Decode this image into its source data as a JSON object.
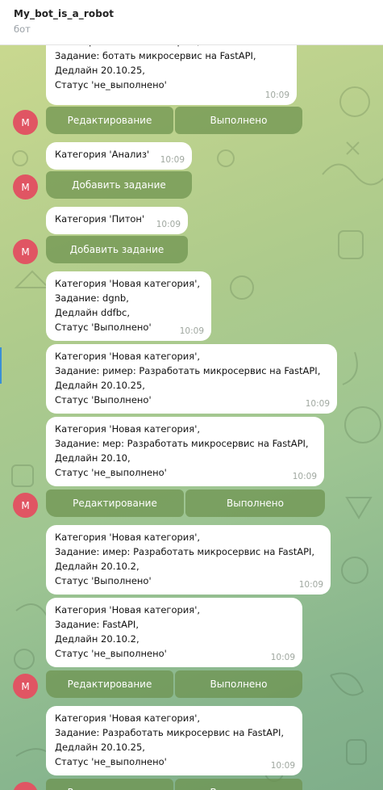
{
  "header": {
    "title": "My_bot_is_a_robot",
    "subtitle": "бот"
  },
  "avatar_letter": "M",
  "messages": [
    {
      "lines": [
        "Категория 'Новая категория',",
        "Задание: ботать микросервис на FastAPI,",
        "Дедлайн 20.10.25,",
        "Статус 'не_выполнено'"
      ],
      "time": "10:09"
    },
    {
      "lines": [
        "Категория 'Анализ'"
      ],
      "time": "10:09"
    },
    {
      "lines": [
        "Категория 'Питон'"
      ],
      "time": "10:09"
    },
    {
      "lines": [
        "Категория 'Новая категория',",
        "Задание: dgnb,",
        "Дедлайн ddfbc,",
        "Статус 'Выполнено'"
      ],
      "time": "10:09"
    },
    {
      "lines": [
        "Категория 'Новая категория',",
        "Задание: ример: Разработать микросервис на FastAPI,",
        "Дедлайн 20.10.25,",
        "Статус 'Выполнено'"
      ],
      "time": "10:09"
    },
    {
      "lines": [
        "Категория 'Новая категория',",
        "Задание: мер: Разработать микросервис на FastAPI,",
        "Дедлайн 20.10,",
        "Статус 'не_выполнено'"
      ],
      "time": "10:09"
    },
    {
      "lines": [
        "Категория 'Новая категория',",
        "Задание: имер: Разработать микросервис на FastAPI,",
        "Дедлайн 20.10.2,",
        "Статус 'Выполнено'"
      ],
      "time": "10:09"
    },
    {
      "lines": [
        "Категория 'Новая категория',",
        "Задание: FastAPI,",
        "Дедлайн 20.10.2,",
        "Статус 'не_выполнено'"
      ],
      "time": "10:09"
    },
    {
      "lines": [
        "Категория 'Новая категория',",
        "Задание: Разработать микросервис на FastAPI,",
        "Дедлайн 20.10.25,",
        "Статус 'не_выполнено'"
      ],
      "time": "10:09"
    }
  ],
  "buttons": {
    "edit": "Редактирование",
    "done": "Выполнено",
    "add_task": "Добавить задание"
  },
  "colors": {
    "avatar": "#e05563",
    "button": "#6c914e",
    "bubble": "#ffffff"
  }
}
